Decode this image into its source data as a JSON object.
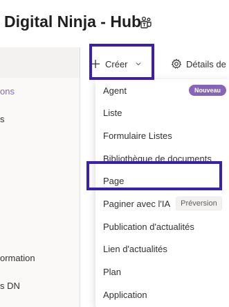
{
  "header": {
    "site_title": "Digital Ninja - Hub",
    "teams_icon": "teams-icon"
  },
  "left_nav": {
    "items": [
      {
        "label": "ons",
        "active": true
      },
      {
        "label": "s",
        "active": false
      },
      {
        "label": "ormation",
        "active": false
      },
      {
        "label": "s DN",
        "active": false
      }
    ]
  },
  "command_bar": {
    "create_label": "Créer",
    "create_icon": "plus-icon",
    "details_label": "Détails de l",
    "details_icon": "gear-icon"
  },
  "create_menu": {
    "items": [
      {
        "label": "Agent",
        "badge": "Nouveau"
      },
      {
        "label": "Liste"
      },
      {
        "label": "Formulaire Listes"
      },
      {
        "label": "Bibliothèque de documents"
      },
      {
        "label": "Page"
      },
      {
        "label": "Paginer avec l'IA",
        "badge": "Préversion"
      },
      {
        "label": "Publication d'actualités"
      },
      {
        "label": "Lien d'actualités"
      },
      {
        "label": "Plan"
      },
      {
        "label": "Application"
      }
    ]
  },
  "colors": {
    "accent": "#8764b8",
    "highlight_box": "#3a1fb0"
  }
}
